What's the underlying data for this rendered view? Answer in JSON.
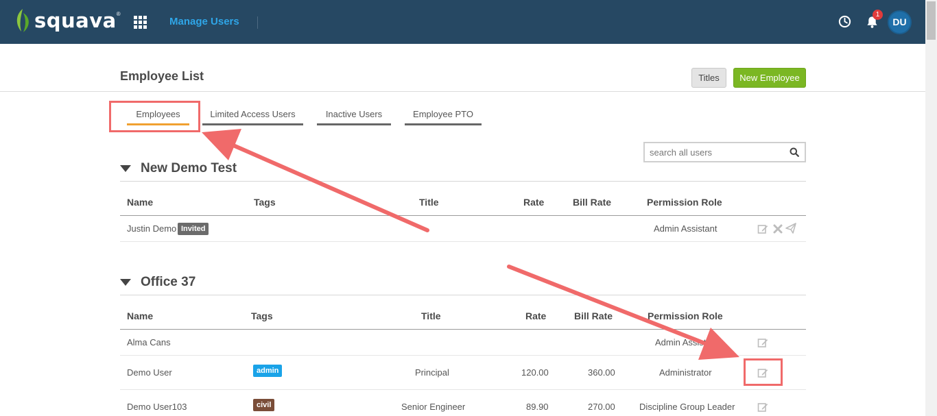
{
  "app": {
    "logo_text": "squava",
    "logo_tm": "®",
    "nav_title": "Manage Users",
    "notification_count": "1",
    "avatar_initials": "DU",
    "colors": {
      "topbar": "#264863",
      "accent": "#2fa6e8",
      "primary_button": "#7bb723",
      "active_tab": "#f0a030",
      "annotation": "#f06a6a"
    }
  },
  "page": {
    "title": "Employee List",
    "titles_button": "Titles",
    "new_employee_button": "New Employee"
  },
  "tabs": [
    {
      "label": "Employees",
      "active": true
    },
    {
      "label": "Limited Access Users",
      "active": false
    },
    {
      "label": "Inactive Users",
      "active": false
    },
    {
      "label": "Employee PTO",
      "active": false
    }
  ],
  "search": {
    "placeholder": "search all users"
  },
  "columns": [
    "Name",
    "Tags",
    "Title",
    "Rate",
    "Bill Rate",
    "Permission Role"
  ],
  "groups": [
    {
      "name": "New Demo Test",
      "rows": [
        {
          "name": "Justin Demo",
          "tag": "Invited",
          "title": "",
          "rate": "",
          "bill_rate": "",
          "role": "Admin Assistant"
        }
      ]
    },
    {
      "name": "Office 37",
      "rows": [
        {
          "name": "Alma Cans",
          "tag": "",
          "title": "",
          "rate": "",
          "bill_rate": "",
          "role": "Admin Assistant"
        },
        {
          "name": "Demo User",
          "tag": "admin",
          "title": "Principal",
          "rate": "120.00",
          "bill_rate": "360.00",
          "role": "Administrator"
        },
        {
          "name": "Demo User103",
          "tag": "civil",
          "title": "Senior Engineer",
          "rate": "89.90",
          "bill_rate": "270.00",
          "role": "Discipline Group Leader"
        }
      ]
    }
  ],
  "icons": [
    "grid-icon",
    "clock-icon",
    "bell-icon",
    "search-icon",
    "caret-down-icon",
    "edit-icon",
    "delete-icon",
    "send-invite-icon"
  ]
}
